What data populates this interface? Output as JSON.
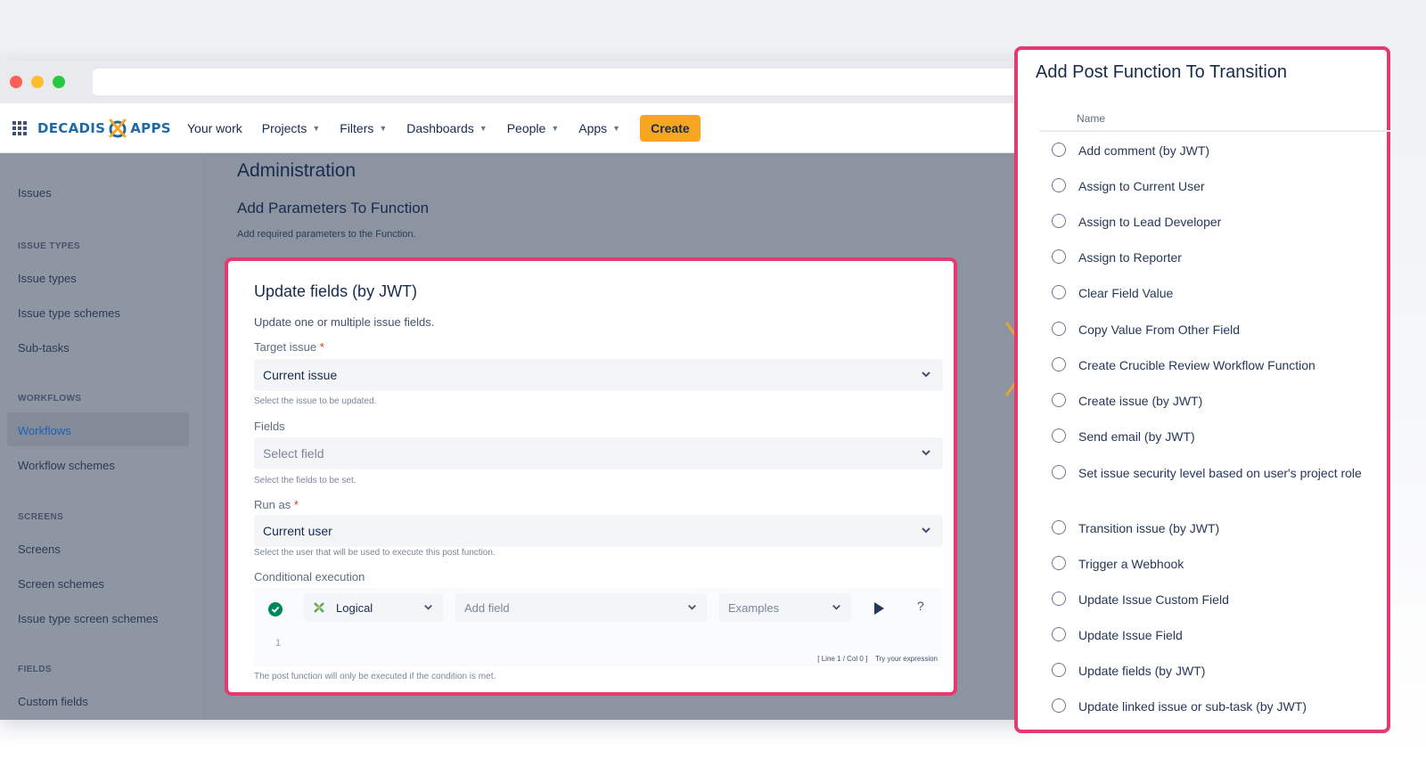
{
  "nav": {
    "logo_left": "DECADIS",
    "logo_right": "APPS",
    "items": [
      {
        "label": "Your work",
        "has_dropdown": false
      },
      {
        "label": "Projects",
        "has_dropdown": true
      },
      {
        "label": "Filters",
        "has_dropdown": true
      },
      {
        "label": "Dashboards",
        "has_dropdown": true
      },
      {
        "label": "People",
        "has_dropdown": true
      },
      {
        "label": "Apps",
        "has_dropdown": true
      }
    ],
    "create_label": "Create",
    "create_color": "#f6a623"
  },
  "sidebar": {
    "issues": "Issues",
    "section_issue_types": "ISSUE TYPES",
    "issue_types": "Issue types",
    "issue_type_schemes": "Issue type schemes",
    "sub_tasks": "Sub-tasks",
    "section_workflows": "WORKFLOWS",
    "workflows": "Workflows",
    "workflow_schemes": "Workflow schemes",
    "section_screens": "SCREENS",
    "screens": "Screens",
    "screen_schemes": "Screen schemes",
    "issue_type_screen_schemes": "Issue type screen schemes",
    "section_fields": "FIELDS",
    "custom_fields": "Custom fields",
    "active_item": "Workflows"
  },
  "main": {
    "title": "Administration",
    "subtitle": "Add Parameters To Function",
    "description": "Add required parameters to the Function."
  },
  "modal": {
    "title": "Update fields (by JWT)",
    "description": "Update one or multiple issue fields.",
    "target_issue_label": "Target issue",
    "target_issue_value": "Current issue",
    "target_issue_help": "Select the issue to be updated.",
    "fields_label": "Fields",
    "fields_placeholder": "Select field",
    "fields_help": "Select the fields to be set.",
    "run_as_label": "Run as",
    "run_as_value": "Current user",
    "run_as_help": "Select the user that will be used to execute this post function.",
    "conditional_label": "Conditional execution",
    "mode_value": "Logical",
    "add_field_placeholder": "Add field",
    "examples_placeholder": "Examples",
    "help_glyph": "?",
    "line_number": "1",
    "cursor_status": "[ Line 1 / Col 0 ]",
    "try_expression": "Try your expression",
    "condition_note": "The post function will only be executed if the condition is met.",
    "required_mark": "*",
    "highlight_color": "#e33b6d"
  },
  "panel": {
    "title": "Add Post Function To Transition",
    "column_header": "Name",
    "options": [
      "Add comment (by JWT)",
      "Assign to Current User",
      "Assign to Lead Developer",
      "Assign to Reporter",
      "Clear Field Value",
      "Copy Value From Other Field",
      "Create Crucible Review Workflow Function",
      "Create issue (by JWT)",
      "Send email (by JWT)",
      "Set issue security level based on user's project role",
      "Transition issue (by JWT)",
      "Trigger a Webhook",
      "Update Issue Custom Field",
      "Update Issue Field",
      "Update fields (by JWT)",
      "Update linked issue or sub-task (by JWT)"
    ]
  }
}
